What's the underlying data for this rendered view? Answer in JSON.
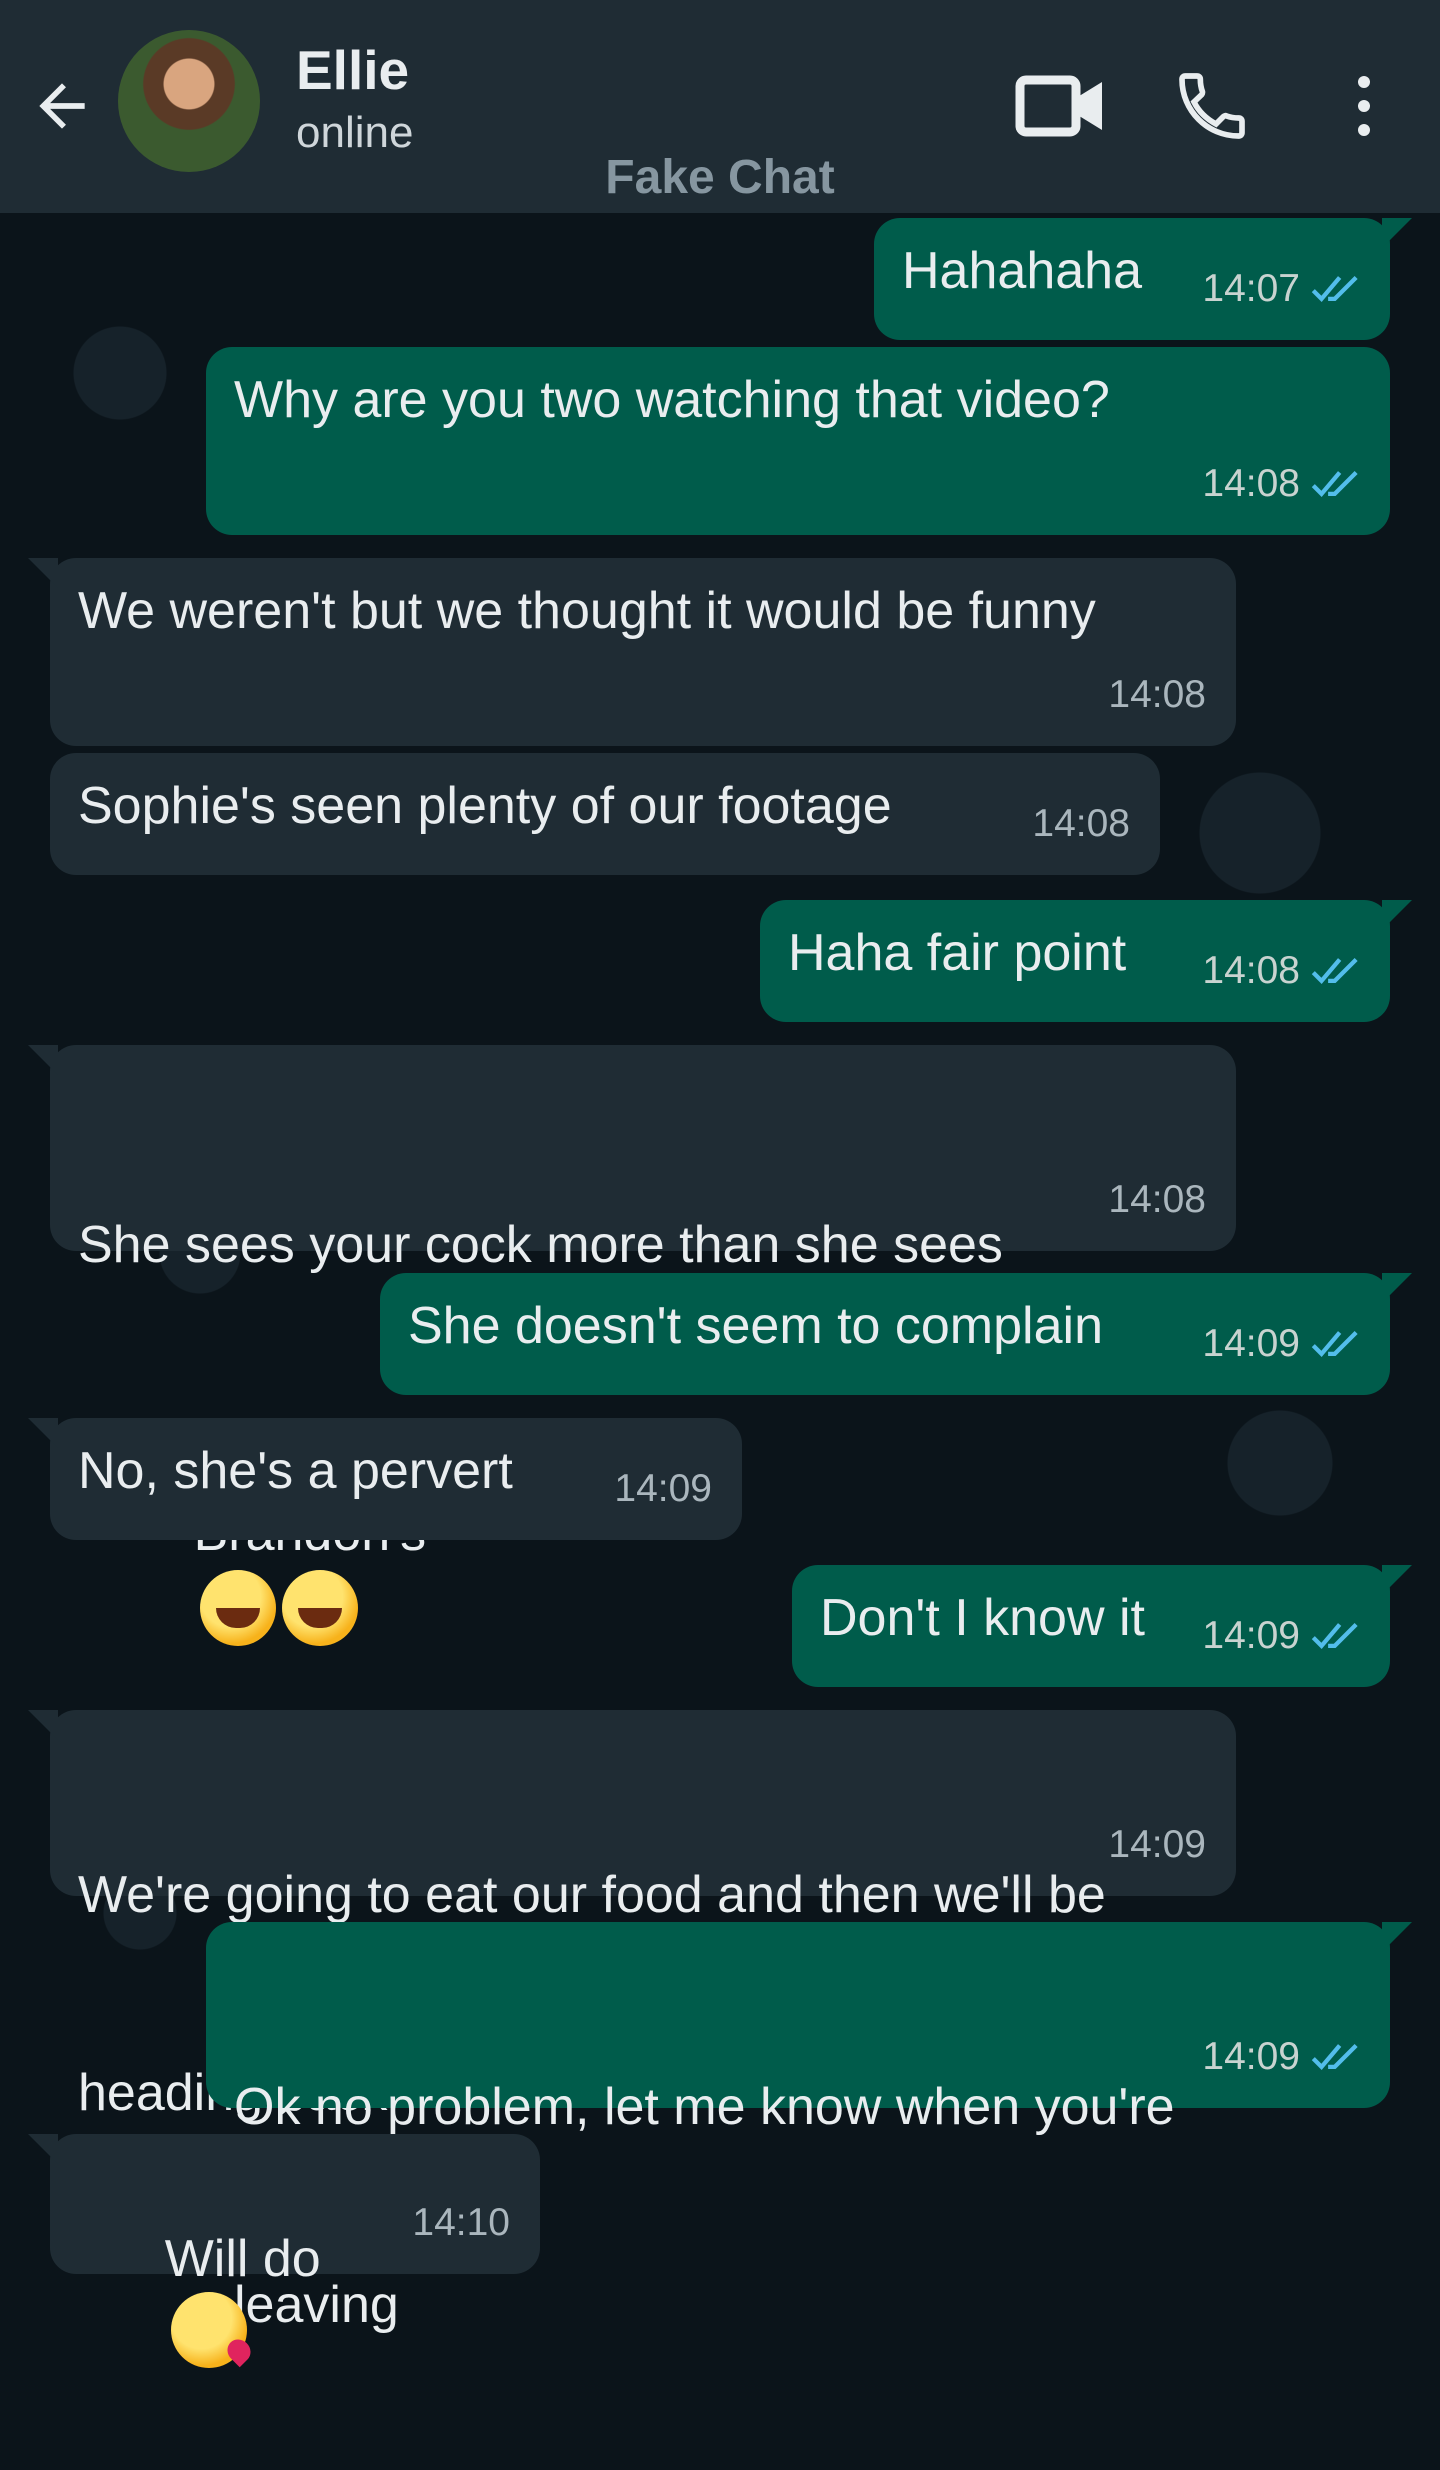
{
  "header": {
    "contact_name": "Ellie",
    "status": "online",
    "watermark": "Fake Chat",
    "icons": [
      "back-arrow-icon",
      "video-call-icon",
      "phone-call-icon",
      "more-options-icon"
    ]
  },
  "messages": [
    {
      "direction": "out",
      "text": "Hahahaha",
      "time": "14:07",
      "read": true
    },
    {
      "direction": "out",
      "text": "Why are you two watching that video?",
      "time": "14:08",
      "read": true
    },
    {
      "direction": "in",
      "text": "We weren't but we thought it would be funny",
      "time": "14:08"
    },
    {
      "direction": "in",
      "text": "Sophie's seen plenty of our footage",
      "time": "14:08"
    },
    {
      "direction": "out",
      "text": "Haha fair point",
      "time": "14:08",
      "read": true
    },
    {
      "direction": "in",
      "text_line1": "She sees your cock more than she sees",
      "text_line2": "Brandon's",
      "emoji": "rolling-on-floor-laughing x2",
      "time": "14:08"
    },
    {
      "direction": "out",
      "text": "She doesn't seem to complain",
      "time": "14:09",
      "read": true
    },
    {
      "direction": "in",
      "text": "No, she's a pervert",
      "time": "14:09"
    },
    {
      "direction": "out",
      "text": "Don't I know it",
      "time": "14:09",
      "read": true
    },
    {
      "direction": "in",
      "text_line1": "We're going to eat our food and then we'll be",
      "text_line2": "heading back",
      "time": "14:09"
    },
    {
      "direction": "out",
      "text_line1": "Ok no problem, let me know when you're",
      "text_line2": "leaving",
      "time": "14:09",
      "read": true
    },
    {
      "direction": "in",
      "text": "Will do",
      "emoji": "face-blowing-a-kiss",
      "time": "14:10"
    }
  ],
  "colors": {
    "header_bg": "#1f2c34",
    "chat_bg": "#0b141a",
    "outgoing_bubble": "#005c4b",
    "incoming_bubble": "#1f2c34",
    "read_ticks": "#53bdeb"
  }
}
